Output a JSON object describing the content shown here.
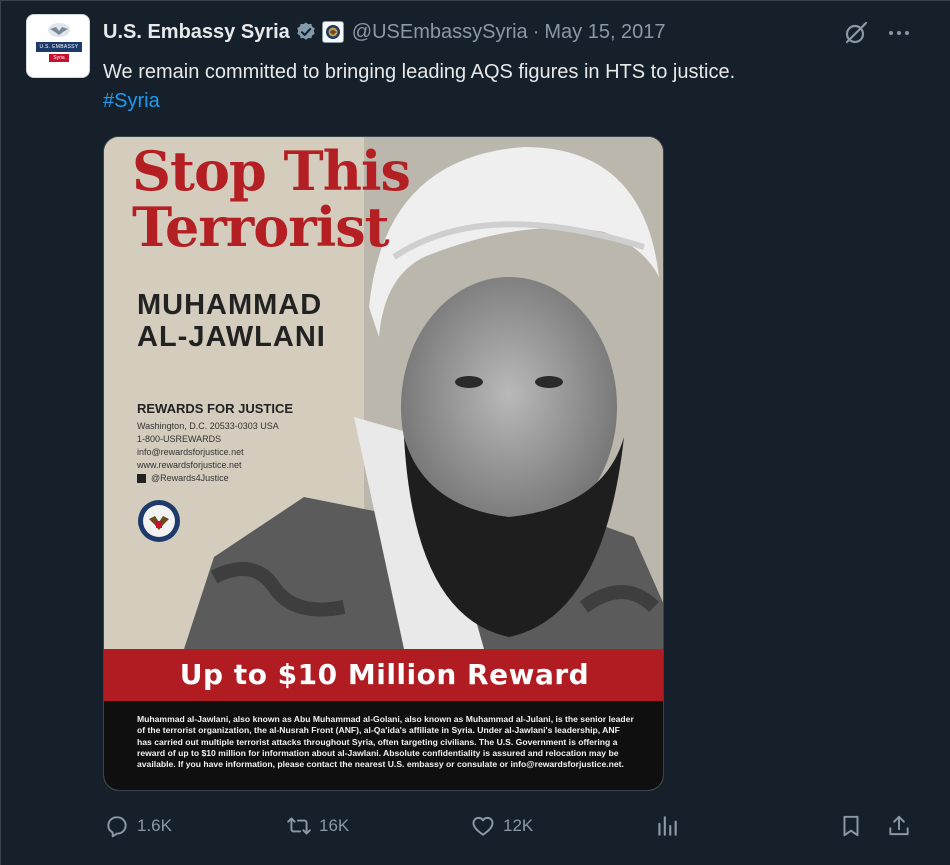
{
  "author": {
    "display_name": "U.S. Embassy Syria",
    "handle": "@USEmbassySyria",
    "date": "May 15, 2017",
    "separator": "·",
    "avatar_text": "U.S. EMBASSY",
    "avatar_subtext": "Syria"
  },
  "tweet": {
    "text": "We remain committed to bringing leading AQS figures in HTS to justice.",
    "hashtag": "#Syria"
  },
  "poster": {
    "title_line1": "Stop This",
    "title_line2": "Terrorist",
    "name_line1": "MUHAMMAD",
    "name_line2": "AL-JAWLANI",
    "rfj_heading": "REWARDS FOR JUSTICE",
    "rfj_lines": [
      "Washington, D.C. 20533-0303 USA",
      "1-800-USREWARDS",
      "info@rewardsforjustice.net",
      "www.rewardsforjustice.net",
      "@Rewards4Justice"
    ],
    "banner": "Up to $10 Million Reward",
    "blurb": "Muhammad al-Jawlani, also known as Abu Muhammad al-Golani, also known as Muhammad al-Julani, is the senior leader of the terrorist organization, the al-Nusrah Front (ANF), al-Qa'ida's affiliate in Syria. Under al-Jawlani's leadership, ANF has carried out multiple terrorist attacks throughout Syria, often targeting civilians. The U.S. Government is offering a reward of up to $10 million for information about al-Jawlani. Absolute confidentiality is assured and relocation may be available. If you have information, please contact the nearest U.S. embassy or consulate or info@rewardsforjustice.net."
  },
  "actions": {
    "replies": "1.6K",
    "retweets": "16K",
    "likes": "12K"
  },
  "icons": [
    "verified-badge-icon",
    "affiliate-seal-icon",
    "grok-icon",
    "more-icon",
    "reply-icon",
    "retweet-icon",
    "like-icon",
    "views-icon",
    "bookmark-icon",
    "share-icon"
  ],
  "colors": {
    "background": "#15202b",
    "text": "#e7e9ea",
    "muted": "#8b98a5",
    "link": "#1d9bf0",
    "poster_red": "#b01c22"
  }
}
